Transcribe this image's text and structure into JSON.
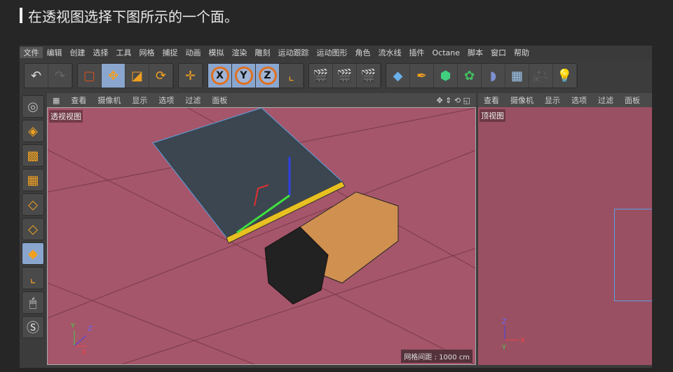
{
  "caption": "在透视图选择下图所示的一个面。",
  "menu": [
    "文件",
    "编辑",
    "创建",
    "选择",
    "工具",
    "网格",
    "捕捉",
    "动画",
    "模拟",
    "渲染",
    "雕刻",
    "运动跟踪",
    "运动图形",
    "角色",
    "流水线",
    "插件",
    "Octane",
    "脚本",
    "窗口",
    "帮助"
  ],
  "view_menu": [
    "查看",
    "摄像机",
    "显示",
    "选项",
    "过滤",
    "面板"
  ],
  "perspective": {
    "label": "透视视图",
    "grid_spacing": "网格间距 : 1000 cm"
  },
  "top_view": {
    "label": "顶视图"
  },
  "axis": {
    "x": "X",
    "y": "Y",
    "z": "Z"
  },
  "colors": {
    "viewport": "#a5566a",
    "top_viewport": "#9a5063",
    "selection": "#5aa0e0",
    "accent": "#f0a020"
  }
}
